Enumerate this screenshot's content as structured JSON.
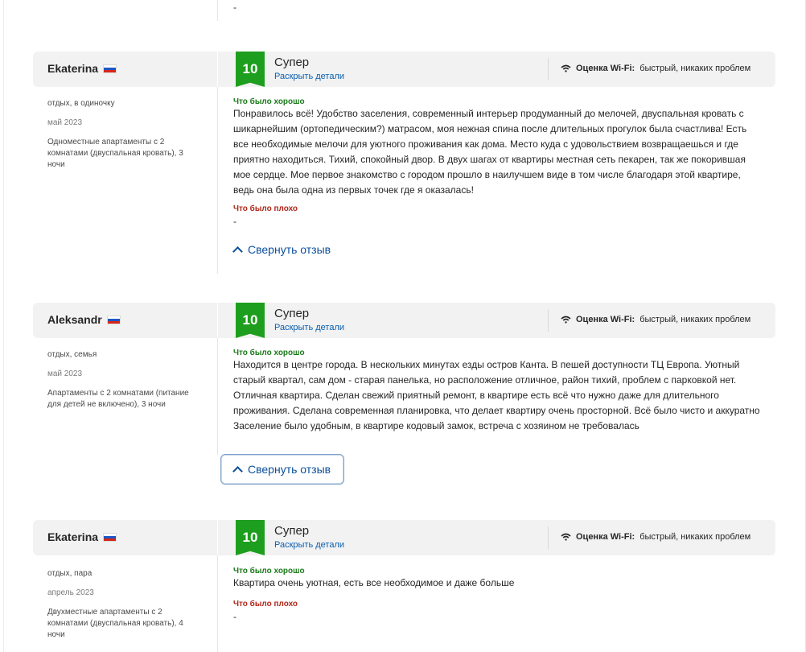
{
  "top_dash": "-",
  "reviews": [
    {
      "author": "Ekaterina",
      "flag": "russia-flag-icon",
      "score": "10",
      "verdict": "Супер",
      "details_link": "Раскрыть детали",
      "wifi_label": "Оценка Wi-Fi:",
      "wifi_value": "быстрый, никаких проблем",
      "trip_type": "отдых, в одиночку",
      "date": "май 2023",
      "room": "Одноместные апартаменты с 2 комнатами (двуспальная кровать), 3 ночи",
      "good_label": "Что было хорошо",
      "good_text": "Понравилось всё! Удобство заселения, современный интерьер продуманный до мелочей, двуспальная кровать с шикарнейшим (ортопедическим?) матрасом, моя нежная спина после длительных прогулок была счастлива! Есть все необходимые мелочи для уютного проживания как дома. Место куда с удовольствием возвращаешься и где приятно находиться. Тихий, спокойный двор. В двух шагах от квартиры местная сеть пекарен, так же покорившая мое сердце. Мое первое знакомство с городом прошло в наилучшем виде в том числе благодаря этой квартире, ведь она была одна из первых точек где я оказалась!",
      "bad_label": "Что было плохо",
      "bad_text": "-",
      "collapse_label": "Свернуть отзыв"
    },
    {
      "author": "Aleksandr",
      "flag": "russia-flag-icon",
      "score": "10",
      "verdict": "Супер",
      "details_link": "Раскрыть детали",
      "wifi_label": "Оценка Wi-Fi:",
      "wifi_value": "быстрый, никаких проблем",
      "trip_type": "отдых, семья",
      "date": "май 2023",
      "room": "Апартаменты с 2 комнатами (питание для детей не включено), 3 ночи",
      "good_label": "Что было хорошо",
      "good_text": "Находится в центре города. В нескольких минутах езды остров Канта. В пешей доступности ТЦ Европа. Уютный старый квартал, сам дом - старая панелька, но расположение отличное, район тихий, проблем с парковкой нет. Отличная квартира. Сделан свежий приятный ремонт, в квартире есть всё что нужно даже для длительного проживания. Сделана современная планировка, что делает квартиру очень просторной. Всё было чисто и аккуратно Заселение было удобным, в квартире кодовый замок, встреча с хозяином не требовалась",
      "collapse_label": "Свернуть отзыв"
    },
    {
      "author": "Ekaterina",
      "flag": "russia-flag-icon",
      "score": "10",
      "verdict": "Супер",
      "details_link": "Раскрыть детали",
      "wifi_label": "Оценка Wi-Fi:",
      "wifi_value": "быстрый, никаких проблем",
      "trip_type": "отдых, пара",
      "date": "апрель 2023",
      "room": "Двухместные апартаменты с 2 комнатами (двуспальная кровать), 4 ночи",
      "good_label": "Что было хорошо",
      "good_text": "Квартира очень уютная, есть все необходимое и даже больше",
      "bad_label": "Что было плохо",
      "bad_text": "-"
    }
  ]
}
